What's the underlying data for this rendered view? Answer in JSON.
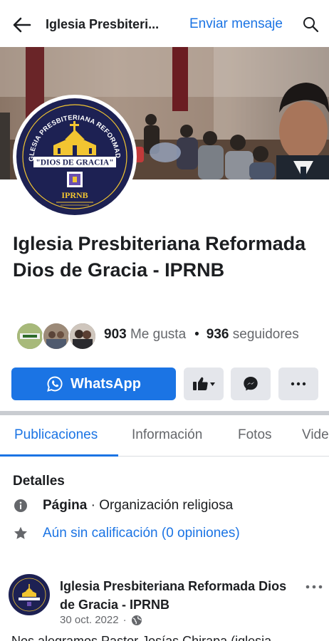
{
  "header": {
    "title": "Iglesia Presbiteri...",
    "send_message": "Enviar mensaje",
    "back_icon": "back-arrow-icon",
    "search_icon": "search-icon"
  },
  "page": {
    "name": "Iglesia Presbiteriana Reformada Dios de Gracia - IPRNB",
    "logo_text": {
      "arc": "IGLESIA PRESBITERIANA REFORMADA",
      "banner": "\"DIOS DE GRACIA\"",
      "acronym": "IPRNB"
    }
  },
  "stats": {
    "likes_count": "903",
    "likes_label": "Me gusta",
    "separator": "•",
    "followers_count": "936",
    "followers_label": "seguidores"
  },
  "actions": {
    "whatsapp_label": "WhatsApp"
  },
  "tabs": [
    {
      "label": "Publicaciones",
      "active": true
    },
    {
      "label": "Información",
      "active": false
    },
    {
      "label": "Fotos",
      "active": false
    },
    {
      "label": "Videos",
      "active": false
    }
  ],
  "details": {
    "title": "Detalles",
    "category_label": "Página",
    "category_value": " · Organización religiosa",
    "rating_text": "Aún sin calificación (0 opiniones)"
  },
  "post": {
    "author": "Iglesia Presbiteriana Reformada Dios de Gracia - IPRNB",
    "date": "30 oct. 2022",
    "meta_separator": "·",
    "text": "Nos alegramos Pastor Josías Chirapa (iglesia"
  },
  "colors": {
    "accent": "#1b74e4",
    "logo_navy": "#1d2153",
    "logo_gold": "#f2c531"
  }
}
